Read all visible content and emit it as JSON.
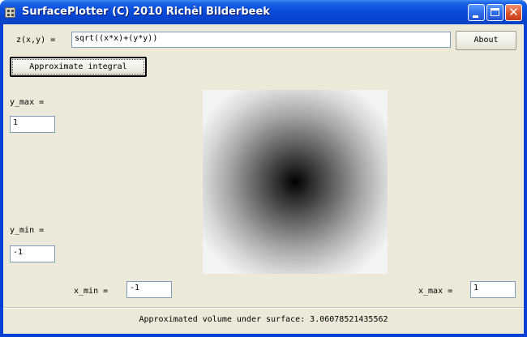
{
  "window": {
    "title": "SurfacePlotter (C) 2010 Richèl Bilderbeek"
  },
  "formula": {
    "label": "z(x,y) =",
    "value": "sqrt((x*x)+(y*y))"
  },
  "buttons": {
    "about": "About",
    "approximate": "Approximate integral"
  },
  "y_max": {
    "label": "y_max =",
    "value": "1"
  },
  "y_min": {
    "label": "y_min =",
    "value": "-1"
  },
  "x_min": {
    "label": "x_min =",
    "value": "-1"
  },
  "x_max": {
    "label": "x_max =",
    "value": "1"
  },
  "status": {
    "text": "Approximated volume under surface: 3.06078521435562"
  },
  "icons": {
    "app": "app-icon",
    "minimize": "minimize-icon",
    "maximize": "maximize-icon",
    "close": "close-icon"
  },
  "colors": {
    "titlebar": "#0a4fdc",
    "client": "#ece9d8",
    "close_button": "#e05a30"
  }
}
